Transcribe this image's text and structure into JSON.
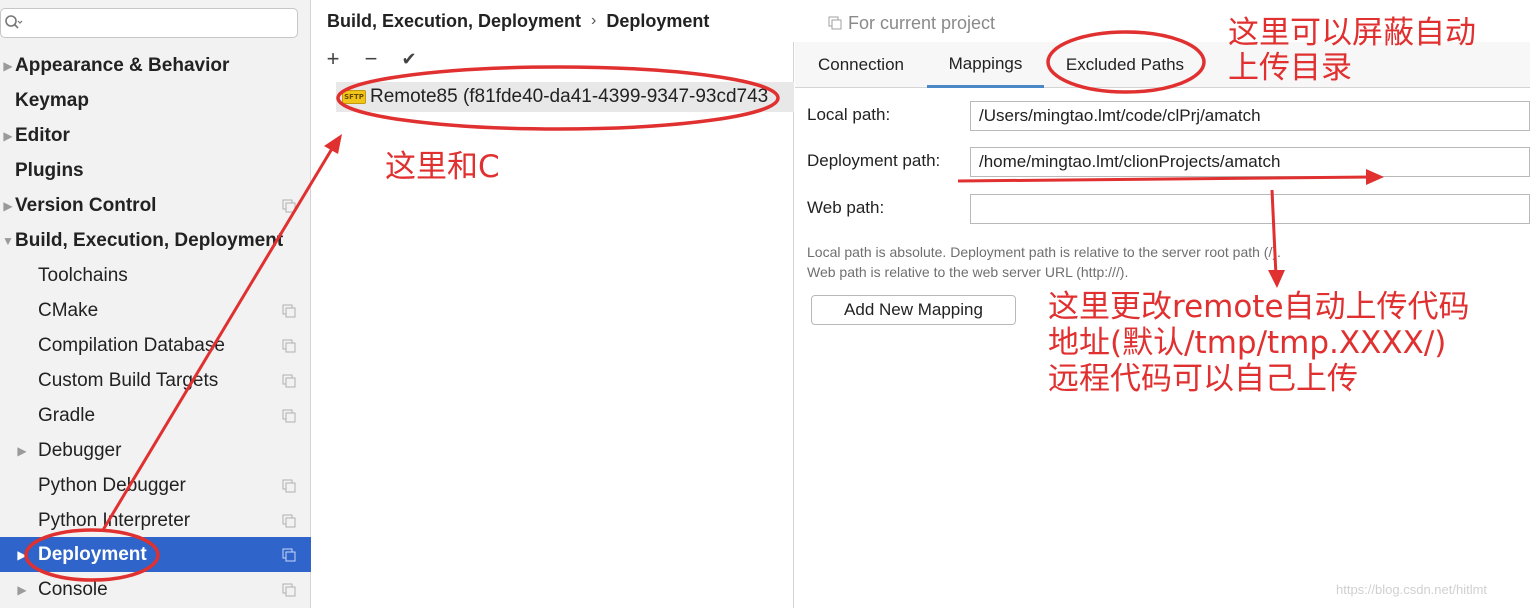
{
  "search": {
    "placeholder": ""
  },
  "sidebar": {
    "items": [
      {
        "label": "Appearance & Behavior"
      },
      {
        "label": "Keymap"
      },
      {
        "label": "Editor"
      },
      {
        "label": "Plugins"
      },
      {
        "label": "Version Control"
      },
      {
        "label": "Build, Execution, Deployment"
      },
      {
        "label": "Toolchains"
      },
      {
        "label": "CMake"
      },
      {
        "label": "Compilation Database"
      },
      {
        "label": "Custom Build Targets"
      },
      {
        "label": "Gradle"
      },
      {
        "label": "Debugger"
      },
      {
        "label": "Python Debugger"
      },
      {
        "label": "Python Interpreter"
      },
      {
        "label": "Deployment"
      },
      {
        "label": "Console"
      }
    ]
  },
  "header": {
    "breadcrumb_parent": "Build, Execution, Deployment",
    "breadcrumb_sep": "›",
    "breadcrumb_current": "Deployment",
    "scope": "For current project"
  },
  "toolbar": {
    "add": "+",
    "remove": "−",
    "apply": "✔"
  },
  "servers": [
    {
      "icon_text": "SFTP",
      "name": "Remote85 (f81fde40-da41-4399-9347-93cd743"
    }
  ],
  "tabs": [
    {
      "label": "Connection"
    },
    {
      "label": "Mappings"
    },
    {
      "label": "Excluded Paths"
    }
  ],
  "mappings": {
    "local_label": "Local path:",
    "local_value": "/Users/mingtao.lmt/code/clPrj/amatch",
    "deploy_label": "Deployment path:",
    "deploy_value": "/home/mingtao.lmt/clionProjects/amatch",
    "web_label": "Web path:",
    "web_value": "",
    "hint1": "Local path is absolute. Deployment path is relative to the server root path (/).",
    "hint2": "Web path is relative to the web server URL (http:///).",
    "add_button": "Add New Mapping"
  },
  "annotations": {
    "middle": "这里和C",
    "excluded_line1": "这里可以屏蔽自动",
    "excluded_line2": "上传目录",
    "remote_line1": "这里更改remote自动上传代码",
    "remote_line2": "地址(默认/tmp/tmp.XXXX/)",
    "remote_line3": "远程代码可以自己上传"
  },
  "watermark": "https://blog.csdn.net/hitlmt",
  "colors": {
    "accent": "#2f65ca",
    "annotation_red": "#e03030",
    "tab_underline": "#4a88c7"
  }
}
